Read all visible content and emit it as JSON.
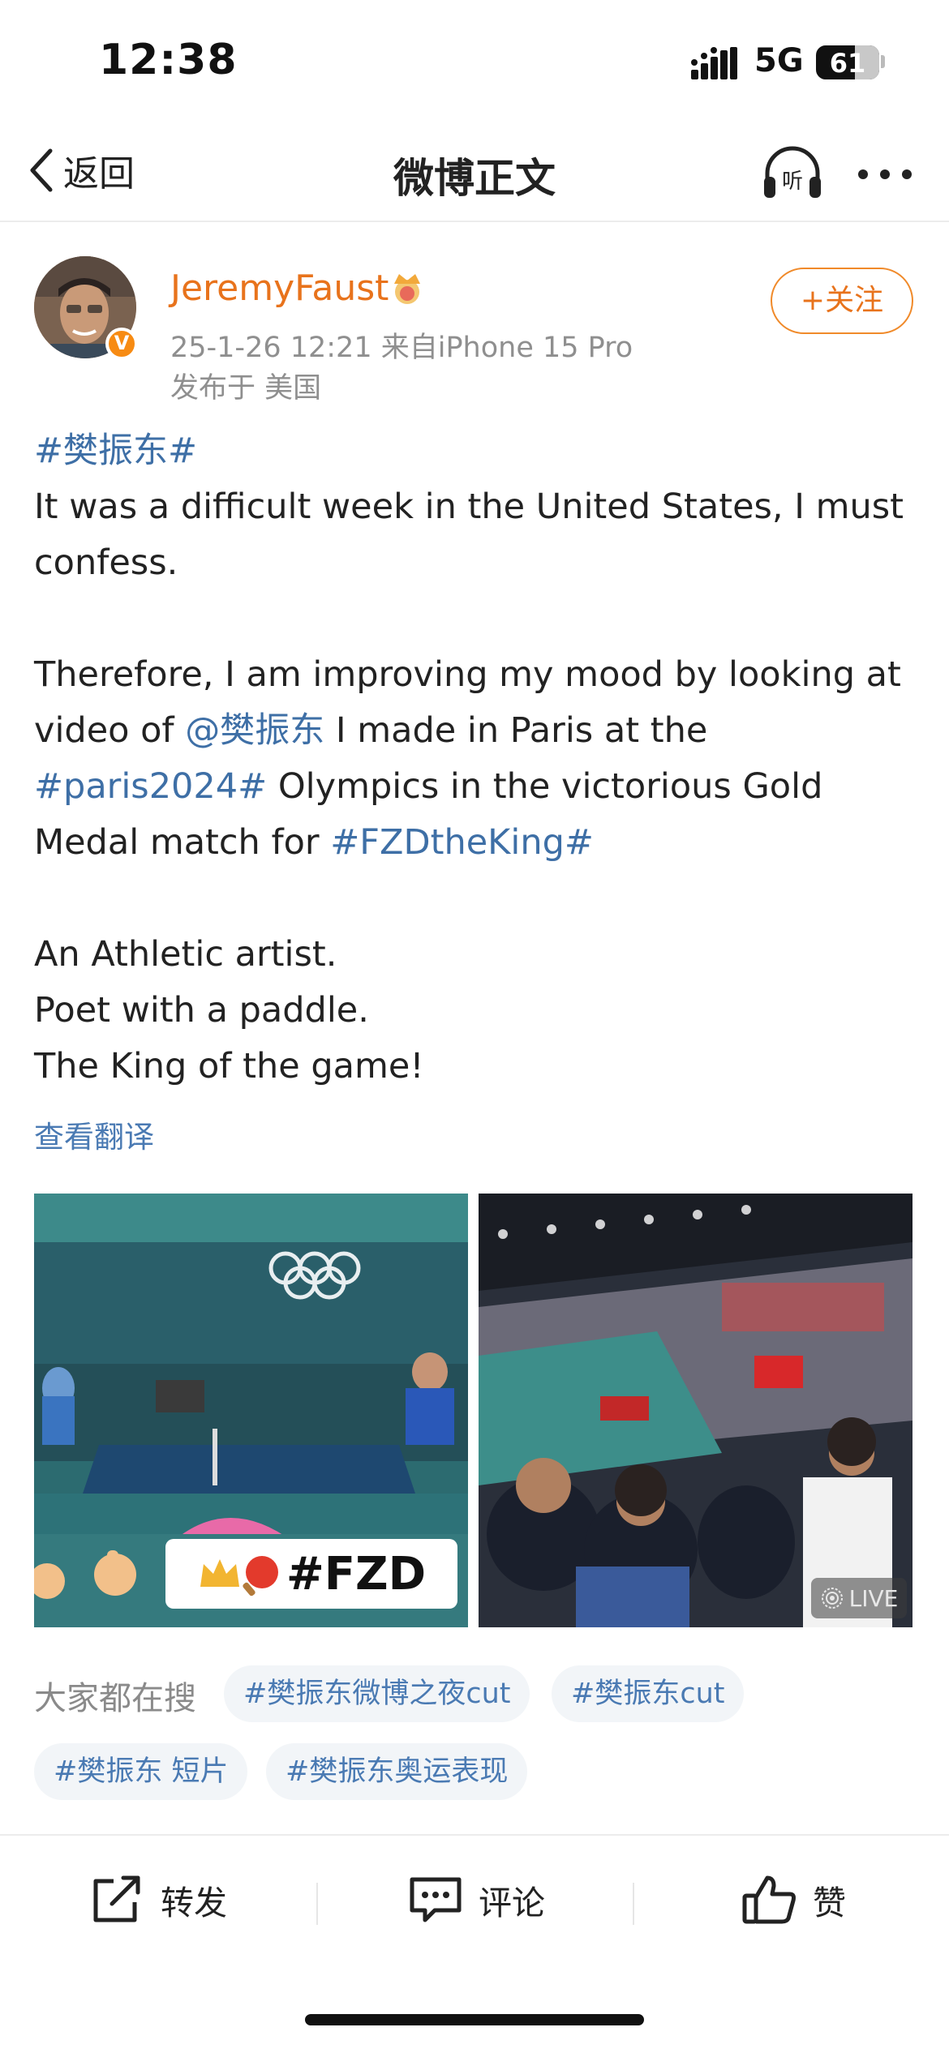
{
  "status_bar": {
    "time": "12:38",
    "network": "5G",
    "battery": "61",
    "battery_level": 0.61
  },
  "nav": {
    "back_label": "返回",
    "title": "微博正文",
    "listen_icon": "headphones-listen-icon",
    "more_icon": "more-dots-icon"
  },
  "author": {
    "name": "JeremyFaust",
    "badge_icon": "crown-icon",
    "verified_icon": "verified-v-icon",
    "verified_mark": "V",
    "meta": "25-1-26 12:21  来自iPhone 15 Pro",
    "location": "发布于 美国",
    "follow_label": "+关注"
  },
  "post": {
    "tag_fzd": "#樊振东#",
    "line1": "It was a difficult week in the United States, I must confess.",
    "line2_a": "Therefore, I am improving my mood by looking at video of ",
    "mention": "@樊振东",
    "line2_b": " I made in Paris at the ",
    "tag_paris": "#paris2024#",
    "line2_c": " Olympics in the victorious Gold Medal match for ",
    "tag_king": "#FZDtheKing#",
    "line3": "An Athletic artist.",
    "line4": "Poet with a paddle.",
    "line5": "The King of the game!",
    "translate_label": "查看翻译"
  },
  "images": {
    "left_badge_text": "#FZD",
    "right_live_label": "LIVE"
  },
  "hot_search": {
    "label": "大家都在搜",
    "tags": [
      "#樊振东微博之夜cut",
      "#樊振东cut",
      "#樊振东 短片",
      "#樊振东奥运表现"
    ]
  },
  "actions": {
    "repost": "转发",
    "comment": "评论",
    "like": "赞"
  },
  "colors": {
    "accent_orange": "#e8731c",
    "link_blue": "#3e6fa6",
    "tag_bg": "#f2f5f8"
  }
}
